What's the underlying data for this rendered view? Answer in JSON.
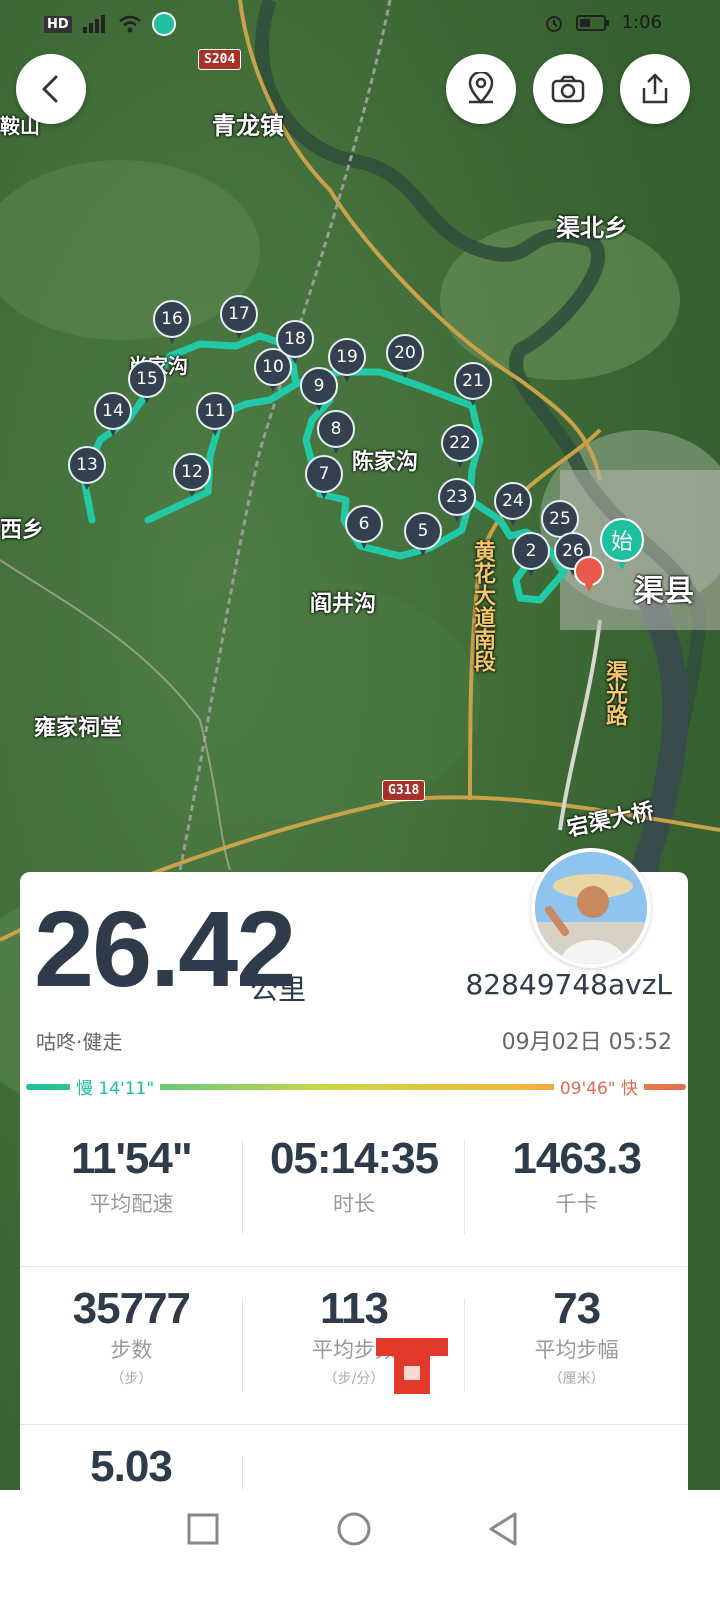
{
  "status_bar": {
    "left": "HD",
    "time": "1:06"
  },
  "map": {
    "labels": [
      "青龙镇",
      "渠北乡",
      "陈家沟",
      "阎井沟",
      "渠县",
      "雍家祠堂",
      "西乡",
      "鞍山",
      "黄花大道南段",
      "渠光路",
      "宕渠大桥",
      "肖家沟"
    ],
    "road_badges": [
      "S204",
      "G318"
    ],
    "markers": [
      "2",
      "5",
      "6",
      "7",
      "8",
      "9",
      "10",
      "11",
      "12",
      "13",
      "14",
      "15",
      "16",
      "17",
      "18",
      "19",
      "20",
      "21",
      "22",
      "23",
      "24",
      "25",
      "26"
    ],
    "start_label": "始"
  },
  "top_buttons": {
    "back": "back",
    "location": "location",
    "camera": "camera",
    "share": "share"
  },
  "summary": {
    "distance": "26.42",
    "unit": "公里",
    "username": "82849748avzL",
    "activity": "咕咚·健走",
    "date": "09月02日 05:52",
    "pace_slow": "慢 14'11\"",
    "pace_fast": "09'46\" 快"
  },
  "stats_row1": [
    {
      "value": "11'54\"",
      "label": "平均配速"
    },
    {
      "value": "05:14:35",
      "label": "时长"
    },
    {
      "value": "1463.3",
      "label": "千卡"
    }
  ],
  "stats_row2": [
    {
      "value": "35777",
      "label": "步数",
      "sub": "（步）"
    },
    {
      "value": "113",
      "label": "平均步频",
      "sub": "（步/分）"
    },
    {
      "value": "73",
      "label": "平均步幅",
      "sub": "（厘米）"
    }
  ],
  "stats_row3": [
    {
      "value": "5.03"
    }
  ],
  "colors": {
    "track": "#22c9a6",
    "pin": "#33404f",
    "slow": "#1bbf9c",
    "fast": "#e26a52"
  }
}
